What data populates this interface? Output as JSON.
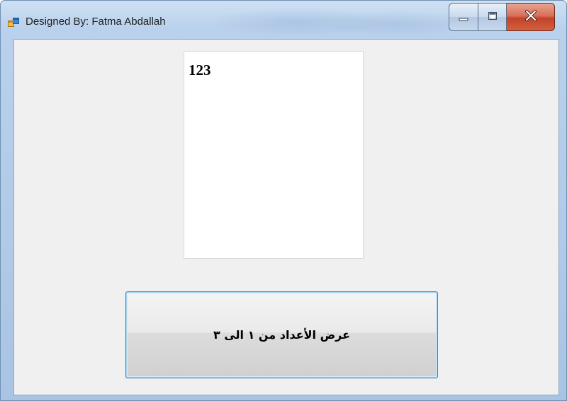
{
  "window": {
    "title": "Designed By: Fatma Abdallah",
    "icon": "winforms-app-icon",
    "controls": {
      "minimize_icon": "minimize-icon",
      "maximize_icon": "maximize-icon",
      "close_icon": "close-icon"
    }
  },
  "display": {
    "value": "123"
  },
  "action_button": {
    "label": "عرض الأعداد من ١ الى ٣"
  },
  "colors": {
    "client_background": "#f0f0f0",
    "display_background": "#ffffff",
    "button_border": "#3c7fb1",
    "close_button": "#c3432a"
  }
}
